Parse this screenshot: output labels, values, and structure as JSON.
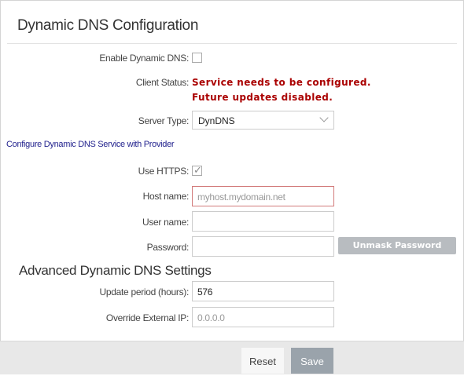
{
  "title": "Dynamic DNS Configuration",
  "enable_ddns": {
    "label": "Enable Dynamic DNS:",
    "checked": false
  },
  "client_status": {
    "label": "Client Status:",
    "line1": "Service needs to be configured.",
    "line2": "Future updates disabled.",
    "color": "#aa0000"
  },
  "server_type": {
    "label": "Server Type:",
    "value": "DynDNS"
  },
  "configure_link": "Configure Dynamic DNS Service with Provider",
  "use_https": {
    "label": "Use HTTPS:",
    "checked": true
  },
  "host_name": {
    "label": "Host name:",
    "placeholder": "myhost.mydomain.net"
  },
  "user_name": {
    "label": "User name:",
    "value": ""
  },
  "password": {
    "label": "Password:",
    "value": ""
  },
  "unmask_button": "Unmask Password",
  "advanced_title": "Advanced Dynamic DNS Settings",
  "update_period": {
    "label": "Update period (hours):",
    "value": "576"
  },
  "override_ip": {
    "label": "Override External IP:",
    "placeholder": "0.0.0.0"
  },
  "footer": {
    "reset_label": "Reset",
    "save_label": "Save"
  }
}
